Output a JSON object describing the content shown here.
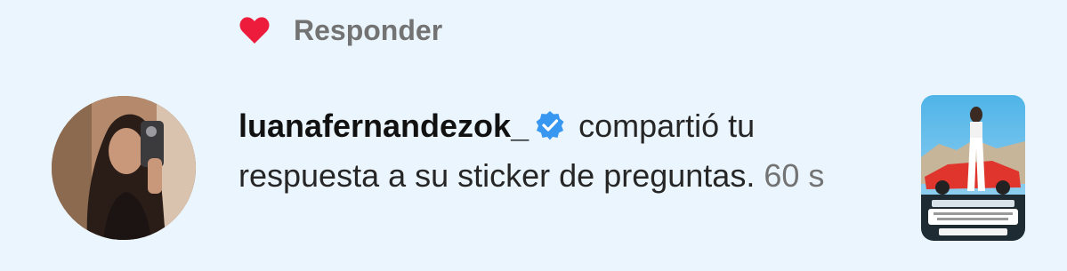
{
  "reply": {
    "label": "Responder",
    "like_icon": "heart-icon",
    "liked_color": "#ed1c3c"
  },
  "notification": {
    "username": "luanafernandezok_",
    "verified_icon": "verified-badge-icon",
    "message_part1": "compartió tu",
    "message_part2": "respuesta a su sticker de preguntas.",
    "time": "60 s"
  },
  "colors": {
    "background": "#eaf5fd",
    "verified": "#3897f0",
    "muted": "#737373"
  }
}
